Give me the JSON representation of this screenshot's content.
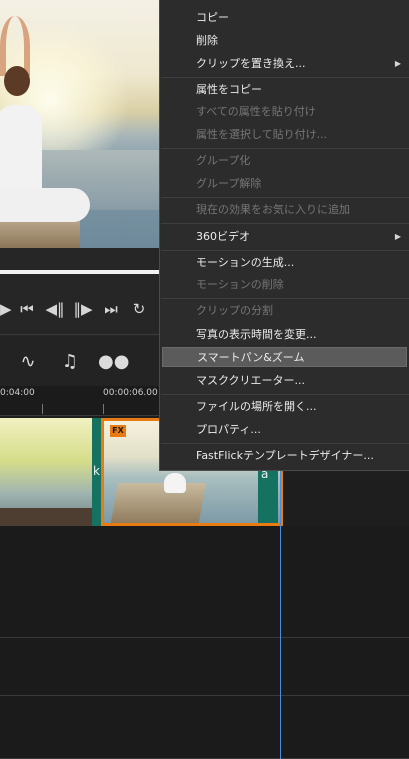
{
  "player": {
    "controls": [
      {
        "name": "play-icon",
        "glyph": "▶"
      },
      {
        "name": "skip-back-icon",
        "glyph": "⏮"
      },
      {
        "name": "prev-frame-icon",
        "glyph": "◀‖"
      },
      {
        "name": "next-frame-icon",
        "glyph": "‖▶"
      },
      {
        "name": "skip-forward-icon",
        "glyph": "⏭"
      },
      {
        "name": "repeat-icon",
        "glyph": "↻"
      }
    ]
  },
  "timeline": {
    "toolbar": [
      {
        "name": "audio-wave-icon",
        "glyph": "∿"
      },
      {
        "name": "music-note-icon",
        "glyph": "♫"
      },
      {
        "name": "circles-icon",
        "glyph": "●●"
      }
    ],
    "ruler": {
      "tick1": "0:04:00",
      "tick2": "00:00:06.00"
    },
    "clip1_letter": "k",
    "clip2_letter": "a",
    "fx_badge": "FX",
    "accent_color": "#e87c13",
    "track_edge_color": "#157160"
  },
  "context_menu": {
    "items": [
      {
        "label": "コピー",
        "enabled": true
      },
      {
        "label": "削除",
        "enabled": true
      },
      {
        "label": "クリップを置き換え...",
        "enabled": true,
        "submenu": true
      },
      {
        "label": "属性をコピー",
        "enabled": true
      },
      {
        "label": "すべての属性を貼り付け",
        "enabled": false
      },
      {
        "label": "属性を選択して貼り付け...",
        "enabled": false
      },
      {
        "label": "グループ化",
        "enabled": false
      },
      {
        "label": "グループ解除",
        "enabled": false
      },
      {
        "label": "現在の効果をお気に入りに追加",
        "enabled": false
      },
      {
        "label": "360ビデオ",
        "enabled": true,
        "submenu": true
      },
      {
        "label": "モーションの生成...",
        "enabled": true
      },
      {
        "label": "モーションの削除",
        "enabled": false
      },
      {
        "label": "クリップの分割",
        "enabled": false
      },
      {
        "label": "写真の表示時間を変更...",
        "enabled": true
      },
      {
        "label": "スマートパン&ズーム",
        "enabled": true,
        "highlighted": true
      },
      {
        "label": "マスククリエーター...",
        "enabled": true
      },
      {
        "label": "ファイルの場所を開く...",
        "enabled": true
      },
      {
        "label": "プロパティ...",
        "enabled": true
      },
      {
        "label": "FastFlickテンプレートデザイナー...",
        "enabled": true
      }
    ],
    "submenu_arrow": "▶"
  }
}
